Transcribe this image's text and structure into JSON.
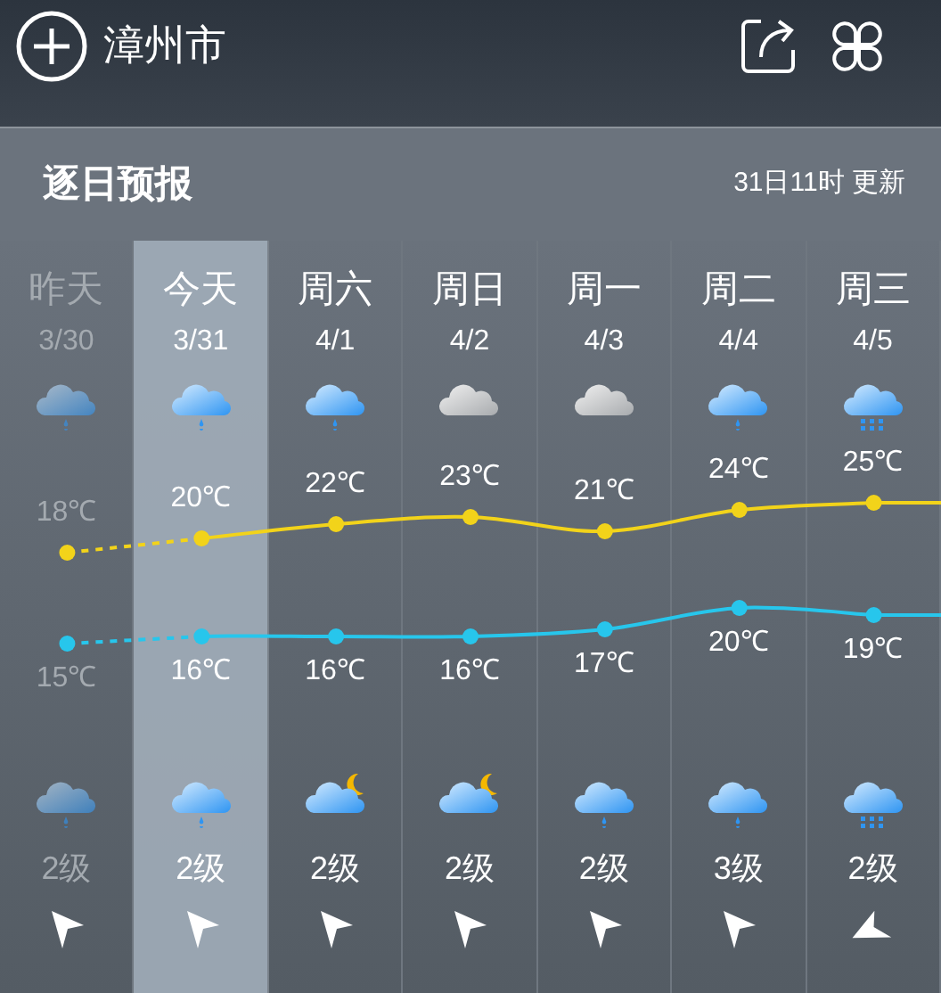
{
  "header": {
    "city": "漳州市"
  },
  "section": {
    "title": "逐日预报",
    "updated": "31日11时 更新"
  },
  "days": [
    {
      "name": "昨天",
      "date": "3/30",
      "past": true,
      "selected": false,
      "day_weather": {
        "kind": "rain"
      },
      "high": "18℃",
      "low": "15℃",
      "night_weather": {
        "kind": "rain"
      },
      "wind": "2级",
      "wind_arrow": {
        "kind": "upleft"
      }
    },
    {
      "name": "今天",
      "date": "3/31",
      "past": false,
      "selected": true,
      "day_weather": {
        "kind": "rain"
      },
      "high": "20℃",
      "low": "16℃",
      "night_weather": {
        "kind": "rain"
      },
      "wind": "2级",
      "wind_arrow": {
        "kind": "upleft"
      }
    },
    {
      "name": "周六",
      "date": "4/1",
      "past": false,
      "selected": false,
      "day_weather": {
        "kind": "rain"
      },
      "high": "22℃",
      "low": "16℃",
      "night_weather": {
        "kind": "moonlit"
      },
      "wind": "2级",
      "wind_arrow": {
        "kind": "upleft"
      }
    },
    {
      "name": "周日",
      "date": "4/2",
      "past": false,
      "selected": false,
      "day_weather": {
        "kind": "overcast"
      },
      "high": "23℃",
      "low": "16℃",
      "night_weather": {
        "kind": "moonlit"
      },
      "wind": "2级",
      "wind_arrow": {
        "kind": "upleft"
      }
    },
    {
      "name": "周一",
      "date": "4/3",
      "past": false,
      "selected": false,
      "day_weather": {
        "kind": "overcast"
      },
      "high": "21℃",
      "low": "17℃",
      "night_weather": {
        "kind": "rain"
      },
      "wind": "2级",
      "wind_arrow": {
        "kind": "upleft"
      }
    },
    {
      "name": "周二",
      "date": "4/4",
      "past": false,
      "selected": false,
      "day_weather": {
        "kind": "rain"
      },
      "high": "24℃",
      "low": "20℃",
      "night_weather": {
        "kind": "rain"
      },
      "wind": "3级",
      "wind_arrow": {
        "kind": "upleft"
      }
    },
    {
      "name": "周三",
      "date": "4/5",
      "past": false,
      "selected": false,
      "day_weather": {
        "kind": "downpour"
      },
      "high": "25℃",
      "low": "19℃",
      "night_weather": {
        "kind": "downpour"
      },
      "wind": "2级",
      "wind_arrow": {
        "kind": "left"
      }
    }
  ]
}
